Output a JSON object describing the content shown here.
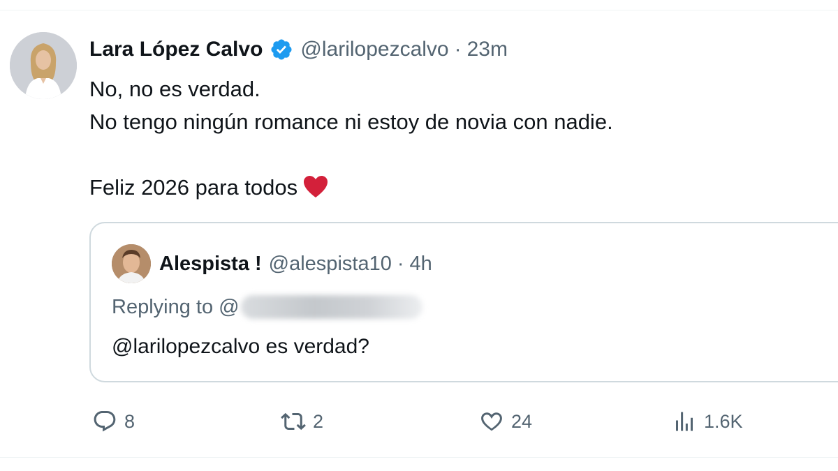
{
  "tweet": {
    "author_name": "Lara López Calvo",
    "author_handle": "@larilopezcalvo",
    "separator": "·",
    "time": "23m",
    "lines": [
      "No, no es verdad.",
      "No tengo ningún romance ni estoy de novia con nadie.",
      "Feliz 2026 para todos"
    ],
    "emoji_icon": "red-heart-emoji"
  },
  "quoted": {
    "author_name": "Alespista !",
    "author_handle": "@alespista10",
    "separator": "·",
    "time": "4h",
    "replying_prefix": "Replying to @",
    "text": "@larilopezcalvo es verdad?"
  },
  "actions": {
    "reply": {
      "icon": "reply-icon",
      "count": "8"
    },
    "retweet": {
      "icon": "retweet-icon",
      "count": "2"
    },
    "like": {
      "icon": "heart-icon",
      "count": "24"
    },
    "views": {
      "icon": "views-icon",
      "count": "1.6K"
    }
  },
  "colors": {
    "verified_blue": "#1d9bf0",
    "secondary_text": "#536471",
    "primary_text": "#0f1419",
    "border": "#cfd9de",
    "heart_emoji": "#d3203a"
  }
}
